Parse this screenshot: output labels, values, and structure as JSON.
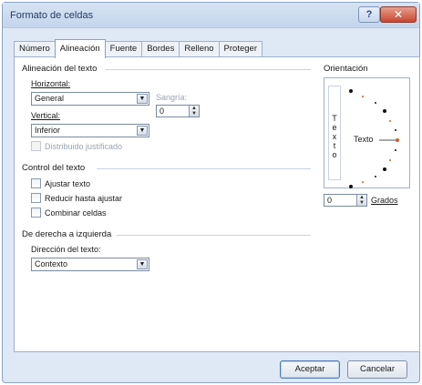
{
  "window": {
    "title": "Formato de celdas",
    "help_label": "?",
    "close_label": "✕"
  },
  "tabs": [
    {
      "label": "Número"
    },
    {
      "label": "Alineación"
    },
    {
      "label": "Fuente"
    },
    {
      "label": "Bordes"
    },
    {
      "label": "Relleno"
    },
    {
      "label": "Proteger"
    }
  ],
  "alignment": {
    "section_label": "Alineación del texto",
    "horizontal_label": "Horizontal:",
    "horizontal_value": "General",
    "indent_label": "Sangría:",
    "indent_value": "0",
    "vertical_label": "Vertical:",
    "vertical_value": "Inferior",
    "distributed_label": "Distribuido justificado"
  },
  "text_control": {
    "section_label": "Control del texto",
    "wrap_label": "Ajustar texto",
    "shrink_label": "Reducir hasta ajustar",
    "merge_label": "Combinar celdas"
  },
  "rtl": {
    "section_label": "De derecha a izquierda",
    "direction_label": "Dirección del texto:",
    "direction_value": "Contexto"
  },
  "orientation": {
    "section_label": "Orientación",
    "vertical_letters": [
      "T",
      "e",
      "x",
      "t",
      "o"
    ],
    "sample_text": "Texto",
    "degrees_value": "0",
    "degrees_label": "Grados"
  },
  "buttons": {
    "ok_label": "Aceptar",
    "cancel_label": "Cancelar"
  }
}
